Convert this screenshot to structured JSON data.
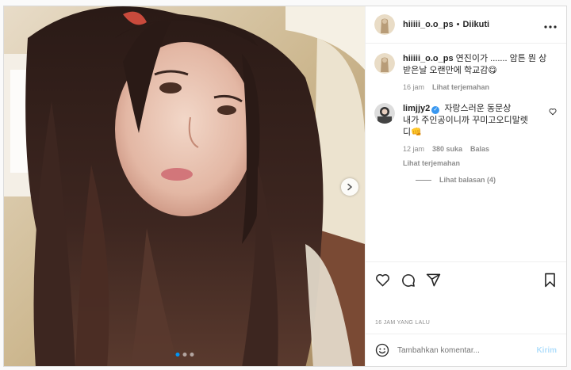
{
  "post": {
    "username": "hiiiii_o.o_ps",
    "separator": "•",
    "follow_status": "Diikuti",
    "more_icon": "more-horizontal-icon",
    "time_ago": "16 JAM YANG LALU"
  },
  "media": {
    "slide_count": 3,
    "active_slide": 1,
    "next_icon": "chevron-right-icon"
  },
  "comments": [
    {
      "username": "hiiiii_o.o_ps",
      "text_line1": "연진이가 ....... 암튼 뭔 상",
      "text_line2": "받은날 오랜만에 학교감😋",
      "time": "16 jam",
      "translate": "Lihat terjemahan",
      "verified": false
    },
    {
      "username": "limjjy2",
      "verified": true,
      "text_line1": "자랑스러운 동문상",
      "text_line2": "내가 주인공이니까 꾸미고오디말렛",
      "text_line3": "디👊",
      "time": "12 jam",
      "likes": "380 suka",
      "reply": "Balas",
      "translate": "Lihat terjemahan",
      "view_replies": "Lihat balasan (4)"
    }
  ],
  "actions": {
    "like_icon": "heart-icon",
    "comment_icon": "comment-icon",
    "share_icon": "send-icon",
    "save_icon": "bookmark-icon"
  },
  "add_comment": {
    "placeholder": "Tambahkan komentar...",
    "send_label": "Kirim",
    "emoji_icon": "emoji-icon"
  },
  "colors": {
    "accent": "#0095f6",
    "send_disabled": "#b2dffc",
    "muted": "#8e8e8e",
    "verified": "#3897f0"
  }
}
